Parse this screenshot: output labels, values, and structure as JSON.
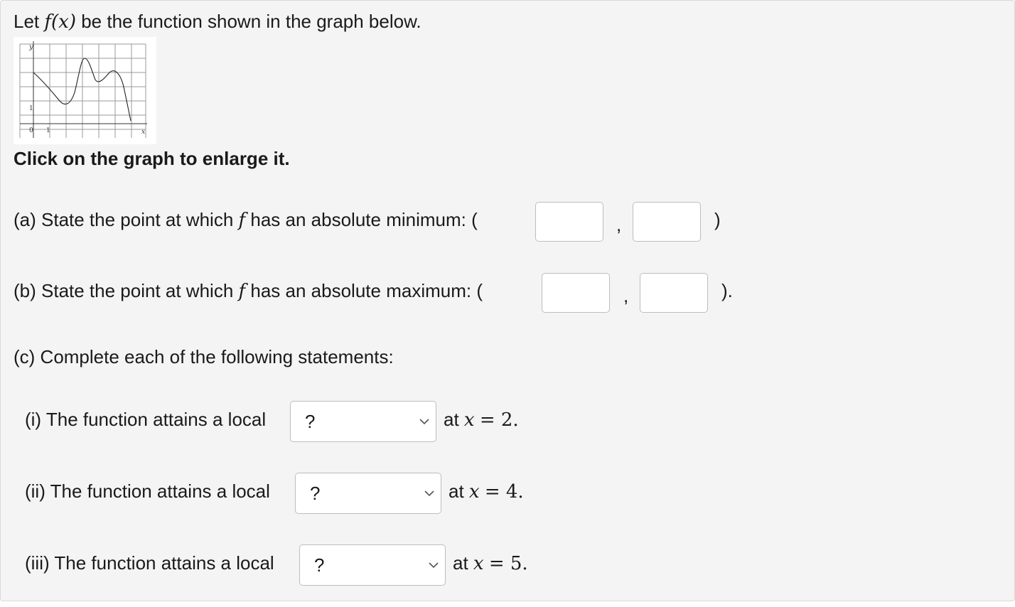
{
  "intro": {
    "prefix": "Let",
    "func": "f(x)",
    "suffix": "be the function shown in the graph below."
  },
  "graph": {
    "y_label": "y",
    "x_label": "x",
    "origin_label": "0",
    "x_tick_label": "1",
    "y_tick_label": "1"
  },
  "enlarge_text": "Click on the graph to enlarge it.",
  "part_a": {
    "prefix": "(a) State the point at which",
    "func": "f",
    "suffix": "has an absolute minimum: (",
    "comma": ",",
    "close": ")",
    "x_value": "",
    "y_value": ""
  },
  "part_b": {
    "prefix": "(b) State the point at which",
    "func": "f",
    "suffix": "has an absolute maximum: (",
    "comma": ",",
    "close": ").",
    "x_value": "",
    "y_value": ""
  },
  "part_c": {
    "heading": "(c) Complete each of the following statements:",
    "items": [
      {
        "label": "(i) The function attains a local",
        "selected": "?",
        "at": "at",
        "var": "x",
        "eq": "= 2."
      },
      {
        "label": "(ii) The function attains a local",
        "selected": "?",
        "at": "at",
        "var": "x",
        "eq": "= 4."
      },
      {
        "label": "(iii) The function attains a local",
        "selected": "?",
        "at": "at",
        "var": "x",
        "eq": "= 5."
      }
    ]
  }
}
